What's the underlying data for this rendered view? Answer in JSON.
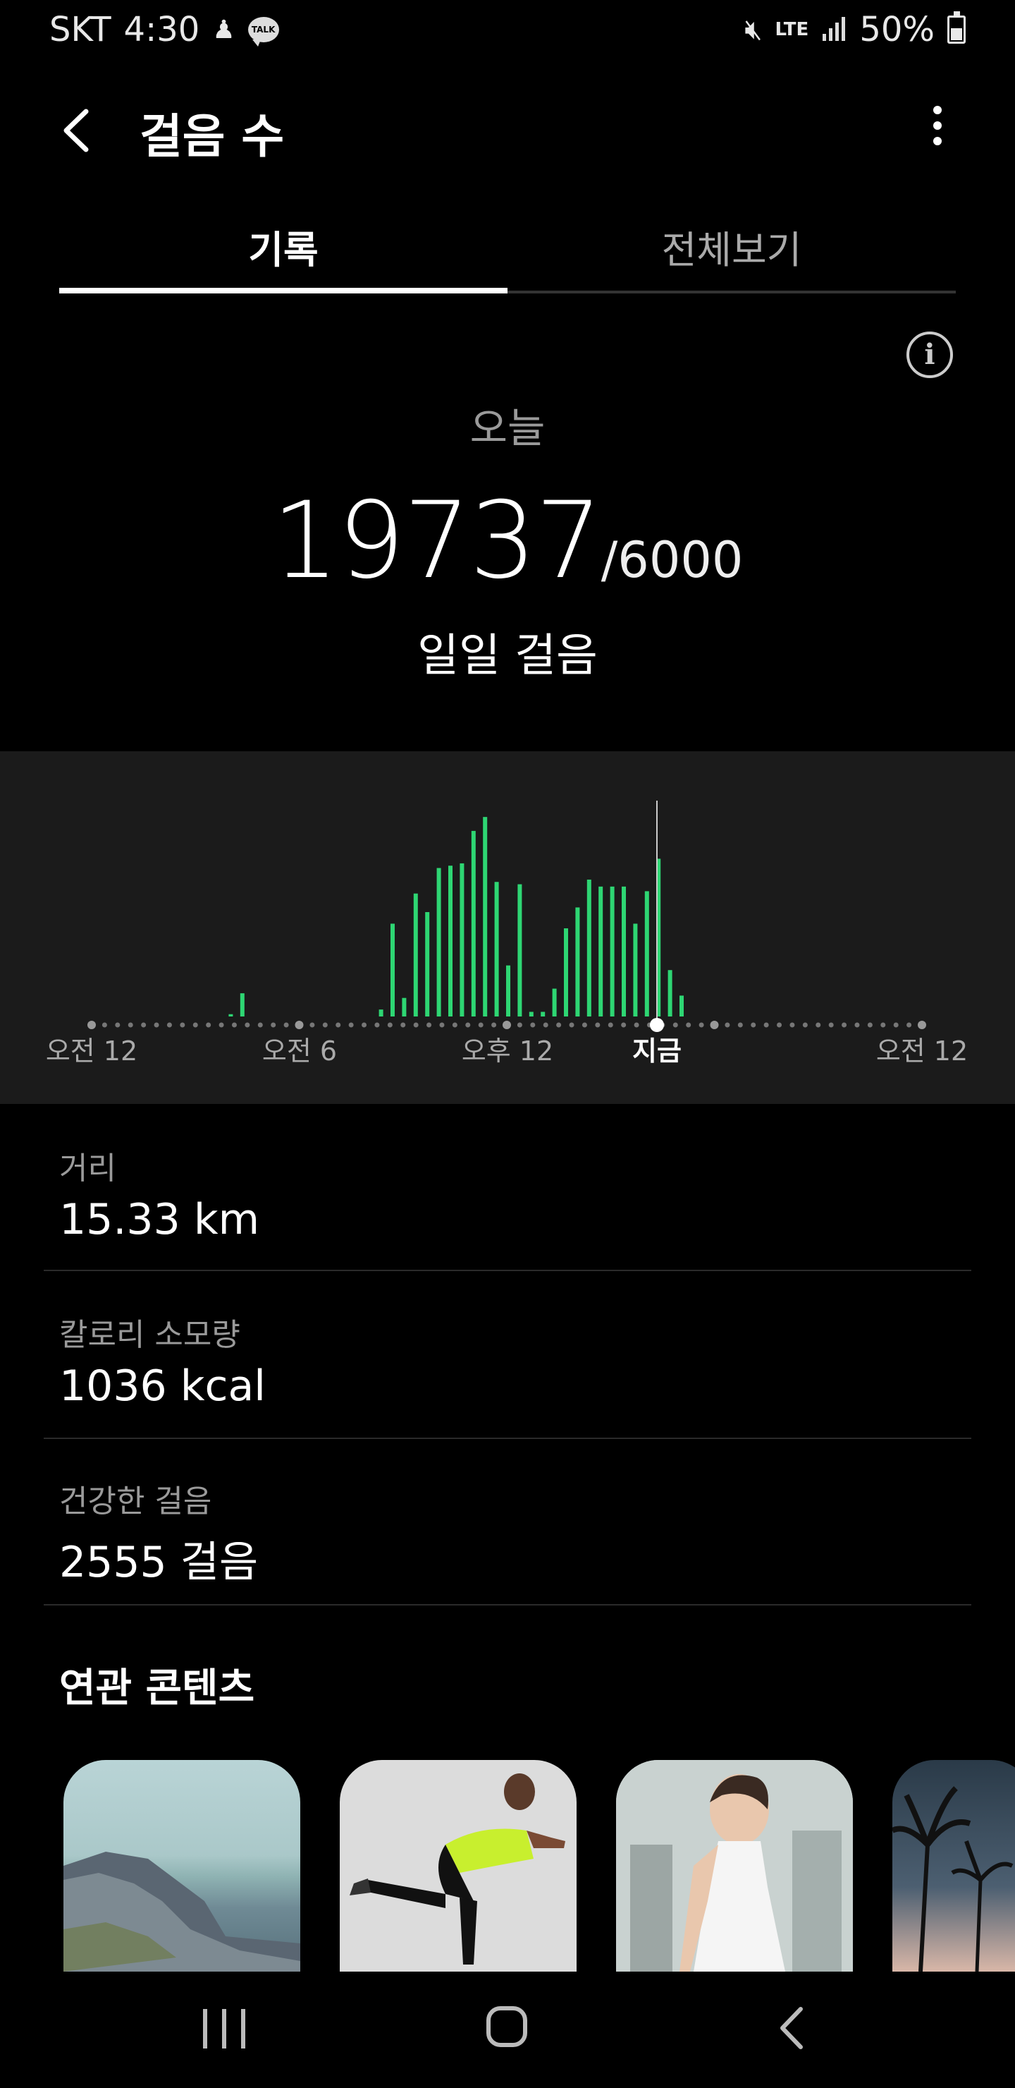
{
  "status_bar": {
    "carrier": "SKT",
    "time": "4:30",
    "talk_badge": "TALK",
    "network": "LTE",
    "battery": "50%"
  },
  "header": {
    "title": "걸음 수"
  },
  "tabs": [
    {
      "label": "기록",
      "active": true
    },
    {
      "label": "전체보기",
      "active": false
    }
  ],
  "summary": {
    "period": "오늘",
    "steps": "19737",
    "goal": "/6000",
    "caption": "일일 걸음"
  },
  "chart_data": {
    "type": "bar",
    "x_tick_labels": [
      "오전 12",
      "오전 6",
      "오후 12",
      "지금",
      "오전 12"
    ],
    "current_marker": "지금",
    "bar_color": "#2ed673",
    "values": [
      0,
      0,
      0,
      0,
      0,
      0,
      1,
      10,
      0,
      0,
      0,
      0,
      0,
      0,
      0,
      0,
      0,
      0,
      0,
      3,
      40,
      8,
      53,
      45,
      64,
      65,
      66,
      80,
      86,
      58,
      22,
      57,
      2,
      2,
      12,
      38,
      47,
      59,
      56,
      56,
      56,
      40,
      54,
      68,
      20,
      9
    ]
  },
  "stats": [
    {
      "label": "거리",
      "value": "15.33 km"
    },
    {
      "label": "칼로리 소모량",
      "value": "1036 kcal"
    },
    {
      "label": "건강한 걸음",
      "value": "2555 걸음"
    }
  ],
  "related": {
    "title": "연관 콘텐츠",
    "cards": [
      "rocky-coast-image",
      "workout-woman-image",
      "fitness-woman-image",
      "palm-trees-image"
    ]
  },
  "icons": {
    "back": "back-arrow-icon",
    "more": "more-vertical-icon",
    "info": "info-icon"
  }
}
